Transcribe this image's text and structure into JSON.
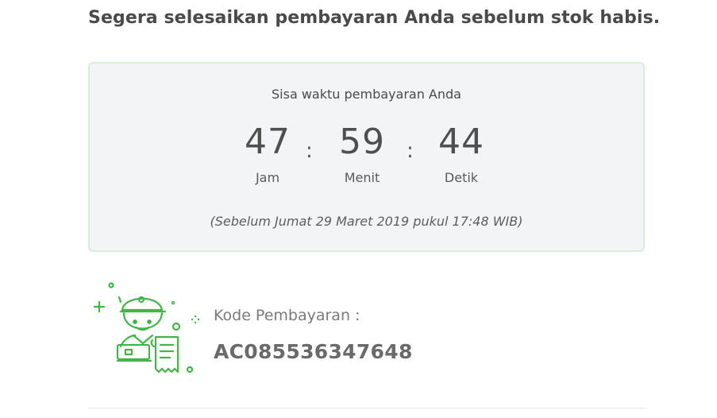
{
  "headline": "Segera selesaikan pembayaran Anda sebelum stok habis.",
  "timer": {
    "title": "Sisa waktu pembayaran Anda",
    "hours": "47",
    "minutes": "59",
    "seconds": "44",
    "hours_label": "Jam",
    "minutes_label": "Menit",
    "seconds_label": "Detik",
    "separator": ":",
    "deadline": "(Sebelum Jumat 29 Maret 2019 pukul 17:48 WIB)"
  },
  "payment": {
    "code_label": "Kode Pembayaran :",
    "code_value": "AC085536347648",
    "illustration": "courier-with-receipt-icon"
  },
  "colors": {
    "accent_green": "#42b549",
    "card_border": "#d6efd6",
    "card_background": "#f3f4f5"
  }
}
